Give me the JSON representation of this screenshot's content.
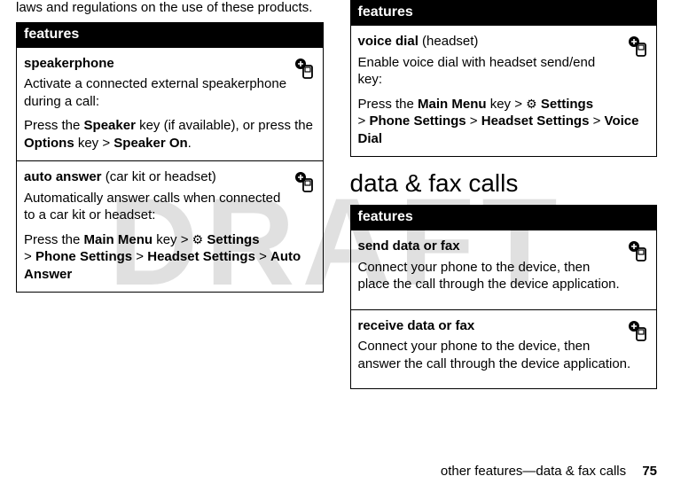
{
  "watermark": "DRAFT",
  "lead_text": "laws and regulations on the use of these products.",
  "features_label": "features",
  "left_table": {
    "rows": [
      {
        "title": "speakerphone",
        "qualifier": "",
        "desc": "Activate a connected external speakerphone during a call:",
        "path_pre": "Press the ",
        "k1": "Speaker",
        "mid1": " key (if available), or press the ",
        "k2": "Options",
        "mid2": " key > ",
        "k3": "Speaker On",
        "tail": "."
      },
      {
        "title": "auto answer",
        "qualifier": " (car kit or headset)",
        "desc": "Automatically answer calls when connected to a car kit or headset:",
        "path_pre": "Press the ",
        "k1": "Main Menu",
        "mid1": " key > ",
        "glyph": "⚙",
        "k2": "Settings",
        "mid2": " > ",
        "k3": "Phone Settings",
        "mid3": " > ",
        "k4": "Headset Settings",
        "mid4": " > ",
        "k5": "Auto Answer",
        "tail": ""
      }
    ]
  },
  "right_top_table": {
    "rows": [
      {
        "title": "voice dial",
        "qualifier": " (headset)",
        "desc": "Enable voice dial with headset send/end key:",
        "path_pre": "Press the ",
        "k1": "Main Menu",
        "mid1": " key > ",
        "glyph": "⚙",
        "k2": "Settings",
        "mid2": " > ",
        "k3": "Phone Settings",
        "mid3": " > ",
        "k4": "Headset Settings",
        "mid4": " > ",
        "k5": "Voice Dial",
        "tail": ""
      }
    ]
  },
  "section_heading": "data & fax calls",
  "right_bottom_table": {
    "rows": [
      {
        "title": "send data or fax",
        "desc": "Connect your phone to the device, then place the call through the device application."
      },
      {
        "title": "receive data or fax",
        "desc": "Connect your phone to the device, then answer the call through the device application."
      }
    ]
  },
  "footer": {
    "text": "other features—data & fax calls",
    "page": "75"
  }
}
